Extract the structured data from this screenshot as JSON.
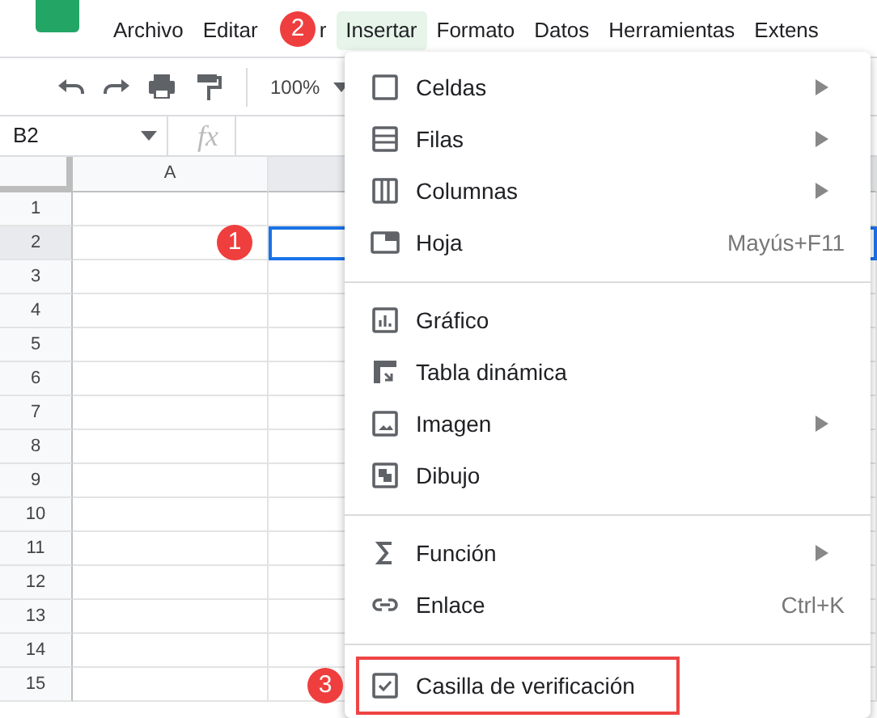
{
  "menu_bar": [
    {
      "label": "Archivo",
      "selected": false
    },
    {
      "label": "Editar",
      "selected": false
    },
    {
      "label": "r",
      "selected": false
    },
    {
      "label": "Insertar",
      "selected": true
    },
    {
      "label": "Formato",
      "selected": false
    },
    {
      "label": "Datos",
      "selected": false
    },
    {
      "label": "Herramientas",
      "selected": false
    },
    {
      "label": "Extens",
      "selected": false
    }
  ],
  "toolbar": {
    "zoom": "100%"
  },
  "formula_bar": {
    "cell_ref": "B2",
    "fx": "fx"
  },
  "sheet": {
    "columns": [
      {
        "label": "A",
        "selected": false
      },
      {
        "selected": true
      }
    ],
    "rows": [
      {
        "label": "1",
        "selected": false
      },
      {
        "label": "2",
        "selected": true
      },
      {
        "label": "3",
        "selected": false
      },
      {
        "label": "4",
        "selected": false
      },
      {
        "label": "5",
        "selected": false
      },
      {
        "label": "6",
        "selected": false
      },
      {
        "label": "7",
        "selected": false
      },
      {
        "label": "8",
        "selected": false
      },
      {
        "label": "9",
        "selected": false
      },
      {
        "label": "10",
        "selected": false
      },
      {
        "label": "11",
        "selected": false
      },
      {
        "label": "12",
        "selected": false
      },
      {
        "label": "13",
        "selected": false
      },
      {
        "label": "14",
        "selected": false
      },
      {
        "label": "15",
        "selected": false
      }
    ]
  },
  "insert_menu": {
    "groups": [
      [
        {
          "label": "Celdas",
          "submenu": true,
          "highlighted": false
        },
        {
          "label": "Filas",
          "submenu": true,
          "highlighted": false
        },
        {
          "label": "Columnas",
          "submenu": true,
          "highlighted": false
        },
        {
          "label": "Hoja",
          "shortcut": "Mayús+F11",
          "submenu": false,
          "highlighted": false
        }
      ],
      [
        {
          "label": "Gráfico",
          "submenu": false,
          "highlighted": false
        },
        {
          "label": "Tabla dinámica",
          "submenu": false,
          "highlighted": false
        },
        {
          "label": "Imagen",
          "submenu": true,
          "highlighted": false
        },
        {
          "label": "Dibujo",
          "submenu": false,
          "highlighted": false
        }
      ],
      [
        {
          "label": "Función",
          "submenu": true,
          "highlighted": false
        },
        {
          "label": "Enlace",
          "shortcut": "Ctrl+K",
          "submenu": false,
          "highlighted": false
        }
      ],
      [
        {
          "label": "Casilla de verificación",
          "submenu": false,
          "highlighted": true
        }
      ]
    ]
  },
  "step_markers": [
    {
      "label": "1"
    },
    {
      "label": "2"
    },
    {
      "label": "3"
    }
  ]
}
